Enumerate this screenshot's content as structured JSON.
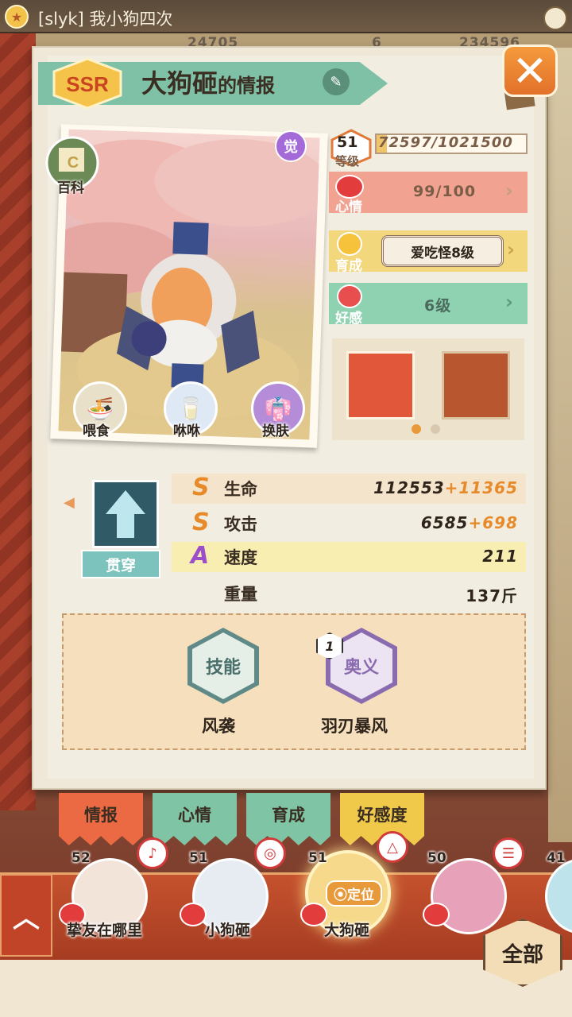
{
  "topbar": {
    "player_name": "[slyk] 我小狗四次",
    "currency_1": "24705",
    "currency_2": "6",
    "currency_3": "234596"
  },
  "header": {
    "rarity": "SSR",
    "shikigami_name": "大狗砸",
    "title_suffix": "的情报"
  },
  "card": {
    "encyclopedia_label": "百科",
    "awaken_label": "觉",
    "actions": [
      {
        "label": "喂食"
      },
      {
        "label": "咻咻"
      },
      {
        "label": "换肤"
      }
    ]
  },
  "status": {
    "level": "51",
    "level_label": "等级",
    "exp": "72597/1021500",
    "mood_label": "心情",
    "mood": "99/100",
    "growth_label": "育成",
    "growth_value": "爱吃怪8级",
    "favor_label": "好感",
    "favor_value": "6级"
  },
  "attack_type": {
    "label": "贯穿"
  },
  "attributes": [
    {
      "grade": "S",
      "name": "生命",
      "base": "112553",
      "bonus": "+11365"
    },
    {
      "grade": "S",
      "name": "攻击",
      "base": "6585",
      "bonus": "+698"
    },
    {
      "grade": "A",
      "name": "速度",
      "base": "211",
      "bonus": ""
    },
    {
      "grade": "",
      "name": "重量",
      "base": "137斤",
      "bonus": ""
    }
  ],
  "skills": [
    {
      "hex_label": "技能",
      "name": "风袭",
      "badge": ""
    },
    {
      "hex_label": "奥义",
      "name": "羽刃暴风",
      "badge": "1"
    }
  ],
  "tabs": [
    {
      "label": "情报"
    },
    {
      "label": "心情"
    },
    {
      "label": "育成"
    },
    {
      "label": "好感度"
    }
  ],
  "roster": [
    {
      "level": "52",
      "name": "挚友在哪里"
    },
    {
      "level": "51",
      "name": "小狗砸"
    },
    {
      "level": "51",
      "name": "大狗砸",
      "locate_label": "定位"
    },
    {
      "level": "50",
      "name": ""
    },
    {
      "level": "41",
      "name": ""
    }
  ],
  "all_button": "全部",
  "colors": {
    "accent_green": "#7fc1a7",
    "mood_red": "#f2a291",
    "growth_yellow": "#f3d77c",
    "favor_green": "#8fd2b1",
    "bonus_orange": "#e68a2a",
    "roster_red": "#c5522e"
  }
}
